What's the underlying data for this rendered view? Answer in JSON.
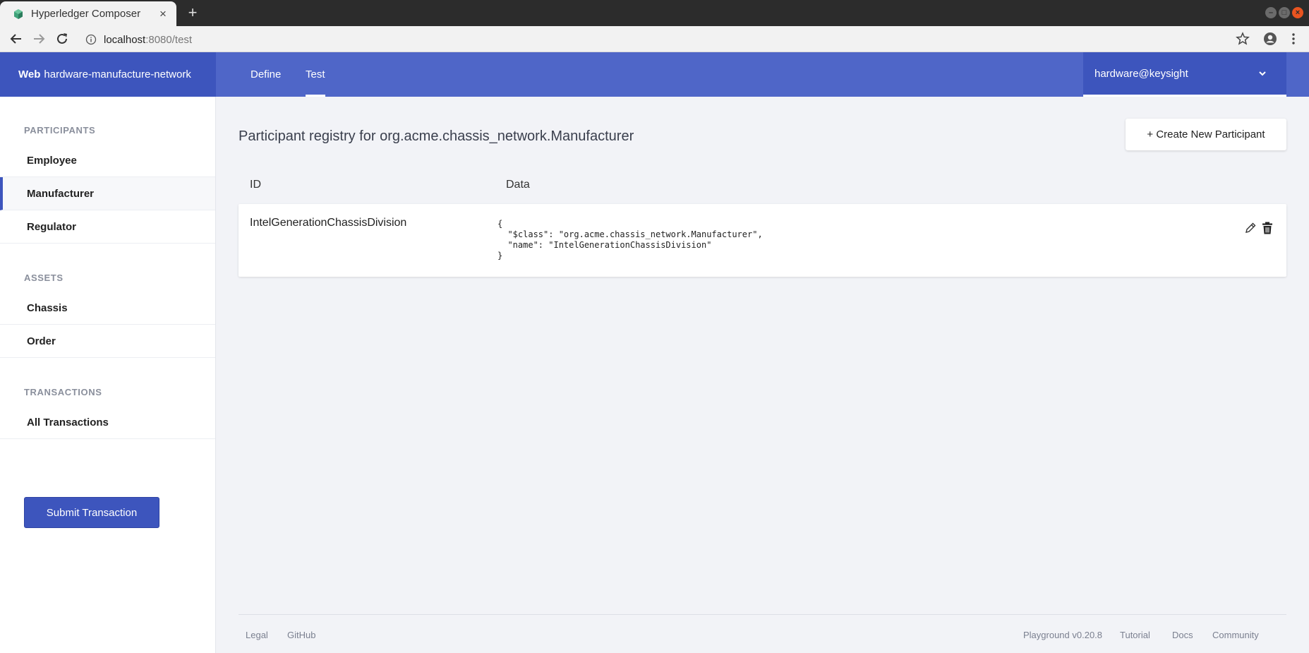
{
  "browser": {
    "tab_title": "Hyperledger Composer",
    "tab_close": "×",
    "new_tab": "+",
    "url_host": "localhost",
    "url_path": ":8080/test"
  },
  "header": {
    "brand_bold": "Web",
    "brand_name": "hardware-manufacture-network",
    "tabs": [
      {
        "label": "Define",
        "active": false
      },
      {
        "label": "Test",
        "active": true
      }
    ],
    "user": "hardware@keysight"
  },
  "sidebar": {
    "participants_heading": "PARTICIPANTS",
    "participants": [
      "Employee",
      "Manufacturer",
      "Regulator"
    ],
    "assets_heading": "ASSETS",
    "assets": [
      "Chassis",
      "Order"
    ],
    "transactions_heading": "TRANSACTIONS",
    "transactions": [
      "All Transactions"
    ],
    "submit_label": "Submit Transaction",
    "accent": "#3d55bd"
  },
  "main": {
    "title": "Participant registry for org.acme.chassis_network.Manufacturer",
    "create_label": "+ Create New Participant",
    "columns": [
      "ID",
      "Data"
    ],
    "rows": [
      {
        "id": "IntelGenerationChassisDivision",
        "data": "{\n  \"$class\": \"org.acme.chassis_network.Manufacturer\",\n  \"name\": \"IntelGenerationChassisDivision\"\n}"
      }
    ]
  },
  "footer": {
    "legal": "Legal",
    "github": "GitHub",
    "version": "Playground v0.20.8",
    "tutorial": "Tutorial",
    "docs": "Docs",
    "community": "Community"
  },
  "icons": [
    "cube-favicon-icon",
    "back-arrow-icon",
    "forward-arrow-icon",
    "reload-icon",
    "info-icon",
    "star-icon",
    "account-icon",
    "kebab-menu-icon",
    "chevron-down-icon",
    "pencil-edit-icon",
    "trash-icon"
  ]
}
